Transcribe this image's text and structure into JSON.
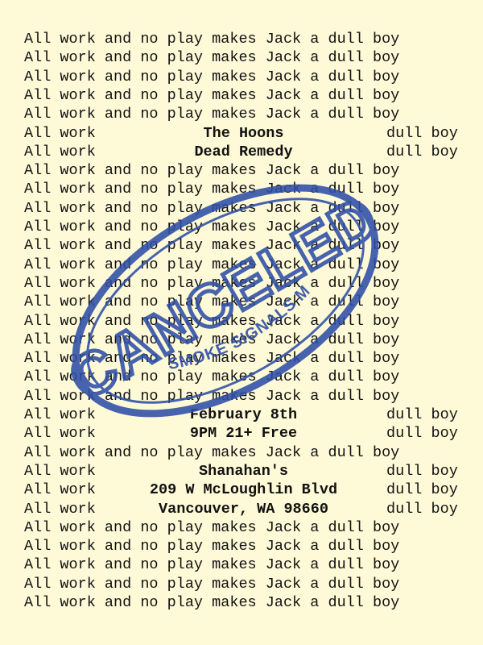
{
  "filler": {
    "full": "All work and no play makes Jack a dull boy",
    "left": "All work",
    "right": "dull boy"
  },
  "lines": [
    {
      "type": "full"
    },
    {
      "type": "full"
    },
    {
      "type": "full"
    },
    {
      "type": "full"
    },
    {
      "type": "full"
    },
    {
      "type": "info",
      "text": "The Hoons"
    },
    {
      "type": "info",
      "text": "Dead Remedy"
    },
    {
      "type": "full"
    },
    {
      "type": "full"
    },
    {
      "type": "full"
    },
    {
      "type": "full"
    },
    {
      "type": "full"
    },
    {
      "type": "full"
    },
    {
      "type": "full"
    },
    {
      "type": "full"
    },
    {
      "type": "full"
    },
    {
      "type": "full"
    },
    {
      "type": "full"
    },
    {
      "type": "full"
    },
    {
      "type": "full"
    },
    {
      "type": "info",
      "text": "February 8th"
    },
    {
      "type": "info",
      "text": "9PM 21+ Free"
    },
    {
      "type": "full"
    },
    {
      "type": "info",
      "text": "Shanahan's"
    },
    {
      "type": "info",
      "text": "209 W McLoughlin Blvd"
    },
    {
      "type": "info",
      "text": "Vancouver, WA 98660"
    },
    {
      "type": "full"
    },
    {
      "type": "full"
    },
    {
      "type": "full"
    },
    {
      "type": "full"
    },
    {
      "type": "full"
    }
  ],
  "stamp": {
    "main_text": "CANCELED",
    "sub_text": "SMOKE SIGNALS MUSIC",
    "color": "#2f4fa8"
  }
}
